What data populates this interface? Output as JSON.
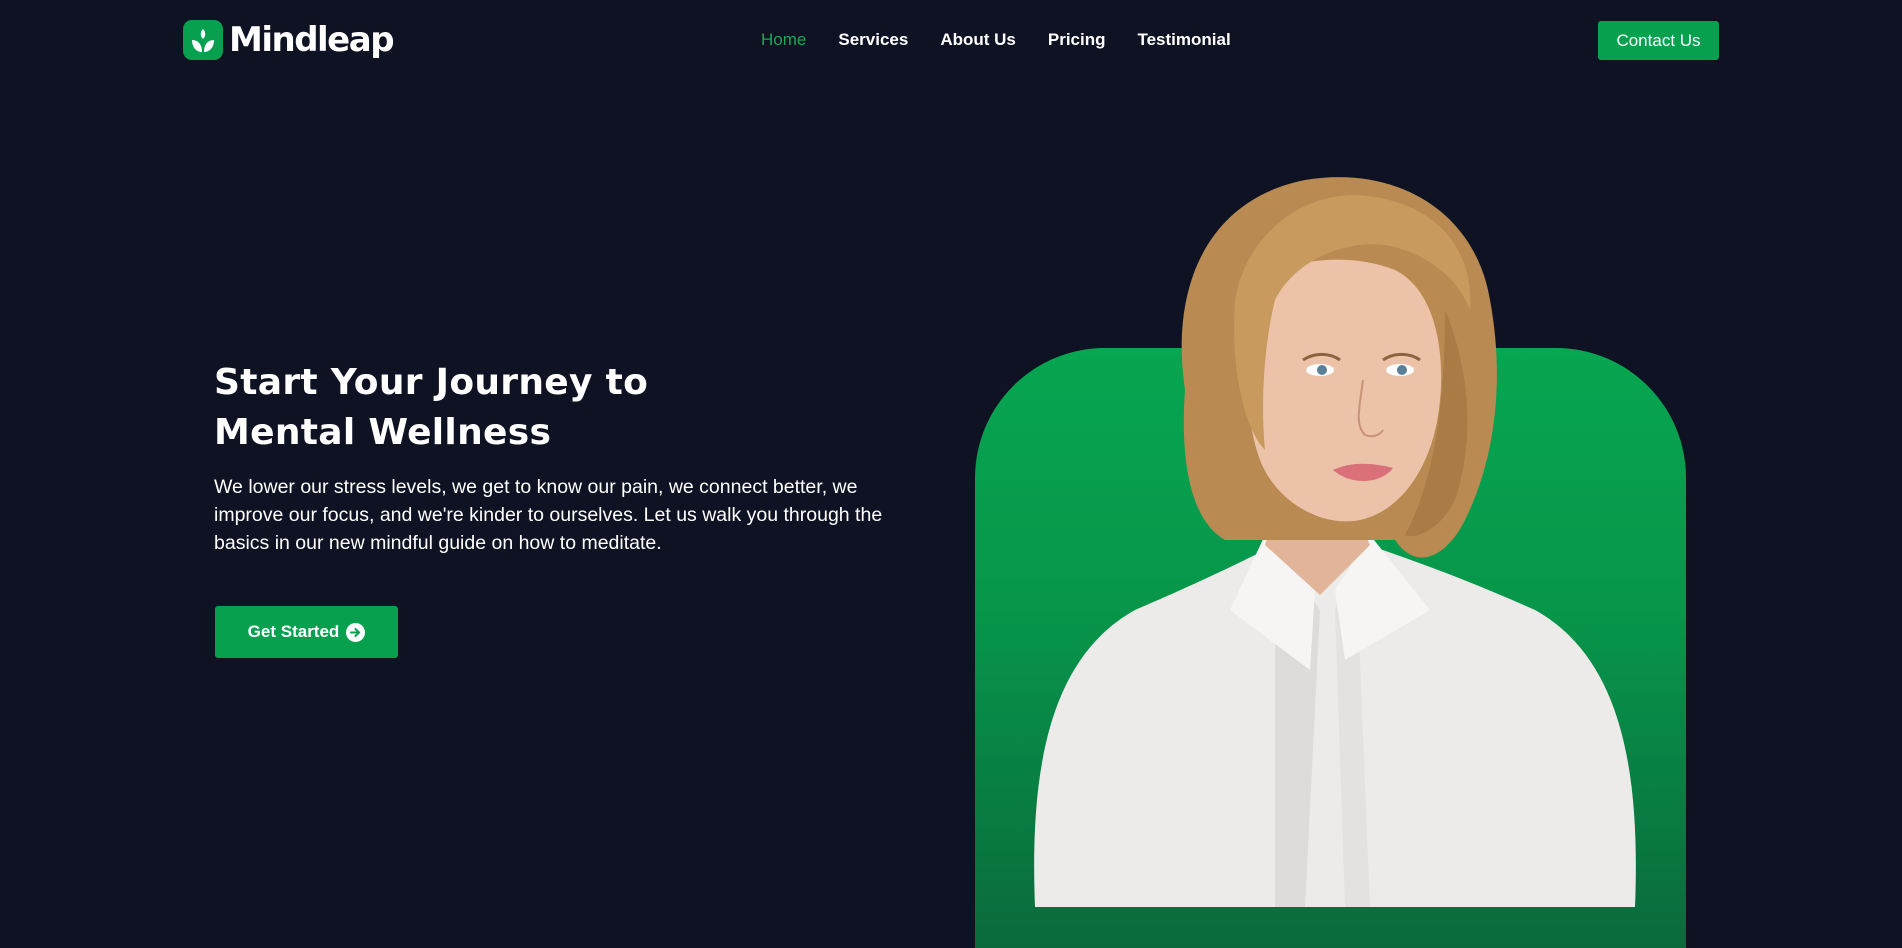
{
  "brand": {
    "name": "Mindleap",
    "accent_color": "#07a04f",
    "background_color": "#0e1223",
    "logo_icon": "leaf-sprout-icon"
  },
  "nav": {
    "items": [
      {
        "label": "Home",
        "active": true
      },
      {
        "label": "Services",
        "active": false
      },
      {
        "label": "About Us",
        "active": false
      },
      {
        "label": "Pricing",
        "active": false
      },
      {
        "label": "Testimonial",
        "active": false
      }
    ]
  },
  "header": {
    "contact_label": "Contact Us"
  },
  "hero": {
    "title_line1": "Start Your Journey to",
    "title_line2": "Mental Wellness",
    "description": "We lower our stress levels, we get to know our pain, we connect better, we improve our focus, and we're kinder to ourselves. Let us walk you through the basics in our new mindful guide on how to meditate.",
    "cta_label": "Get Started",
    "cta_icon": "arrow-right-circle-icon"
  }
}
